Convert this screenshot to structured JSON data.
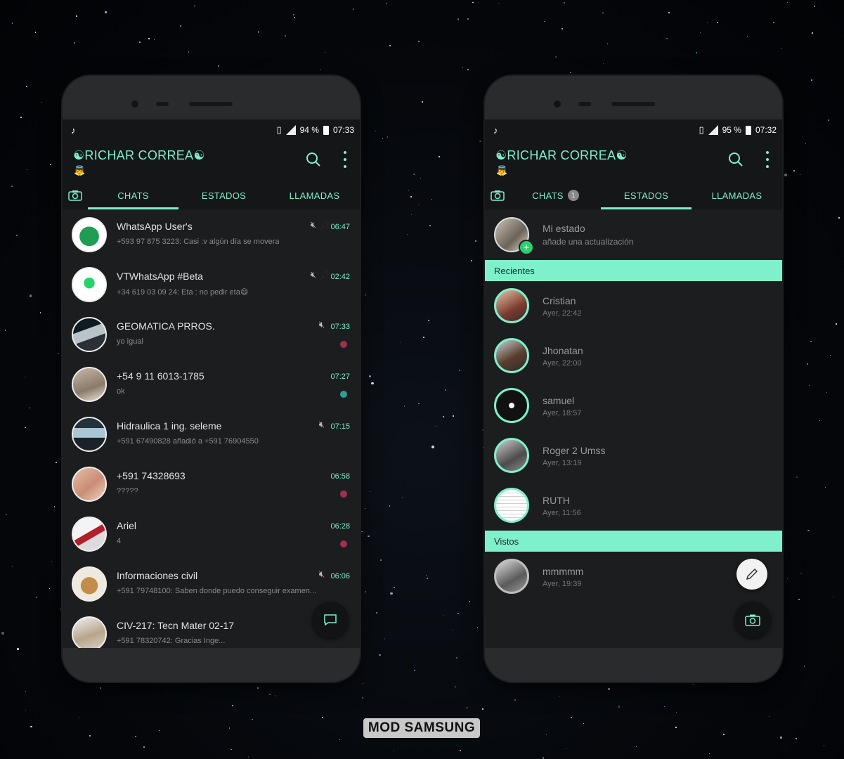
{
  "watermark": "MOD SAMSUNG",
  "colors": {
    "accent": "#7ff0cc",
    "background": "#1c1d1f",
    "bar": "#151617"
  },
  "left_phone": {
    "status": {
      "battery": "94 %",
      "time": "07:33"
    },
    "header": {
      "title": "☯RICHAR CORREA☯",
      "subtitle_icon": "angel-emoji"
    },
    "tabs": [
      {
        "label": "CHATS"
      },
      {
        "label": "ESTADOS"
      },
      {
        "label": "LLAMADAS"
      }
    ],
    "active_tab": "CHATS",
    "chats": [
      {
        "name": "WhatsApp User's",
        "msg": "+593 97 875 3223: Casi :v algún día se movera",
        "time": "06:47",
        "muted": true,
        "pinned": true
      },
      {
        "name": "VTWhatsApp #Beta",
        "msg": "+34 619 03 09 24: Eta : no pedir eta😄",
        "time": "02:42",
        "muted": true,
        "pinned": true
      },
      {
        "name": "GEOMATICA PRROS.",
        "msg": "yo igual",
        "time": "07:33",
        "muted": true,
        "dot": "#a03050"
      },
      {
        "name": "+54 9 11 6013-1785",
        "msg": "ok",
        "time": "07:27",
        "dot": "#30a090"
      },
      {
        "name": "Hidraulica 1 ing. seleme",
        "msg": "+591 67490828 añadió a +591 76904550",
        "time": "07:15",
        "muted": true
      },
      {
        "name": "+591 74328693",
        "msg": "?????",
        "time": "06:58",
        "dot": "#a03050"
      },
      {
        "name": "Ariel",
        "msg": "4",
        "time": "06:28",
        "dot": "#a03050"
      },
      {
        "name": "Informaciones civil",
        "msg": "+591 79748100: Saben donde puedo conseguir examen...",
        "time": "06:06",
        "muted": true
      },
      {
        "name": "CIV-217: Tecn Mater 02-17",
        "msg": "+591 78320742: Gracias Inge...",
        "time": ""
      }
    ]
  },
  "right_phone": {
    "status": {
      "battery": "95 %",
      "time": "07:32"
    },
    "header": {
      "title": "☯RICHAR CORREA☯",
      "subtitle_icon": "angel-emoji"
    },
    "tabs": [
      {
        "label": "CHATS",
        "badge": "1"
      },
      {
        "label": "ESTADOS"
      },
      {
        "label": "LLAMADAS"
      }
    ],
    "active_tab": "ESTADOS",
    "my_status": {
      "label": "Mi estado",
      "sub": "añade una actualización"
    },
    "recent_header": "Recientes",
    "recent": [
      {
        "name": "Cristian",
        "time": "Ayer, 22:42"
      },
      {
        "name": "Jhonatan",
        "time": "Ayer, 22:00"
      },
      {
        "name": "samuel",
        "time": "Ayer, 18:57"
      },
      {
        "name": "Roger 2 Umss",
        "time": "Ayer, 13:19"
      },
      {
        "name": "RUTH",
        "time": "Ayer, 11:56"
      }
    ],
    "viewed_header": "Vistos",
    "viewed": [
      {
        "name": "mmmmm",
        "time": "Ayer, 19:39"
      }
    ]
  }
}
